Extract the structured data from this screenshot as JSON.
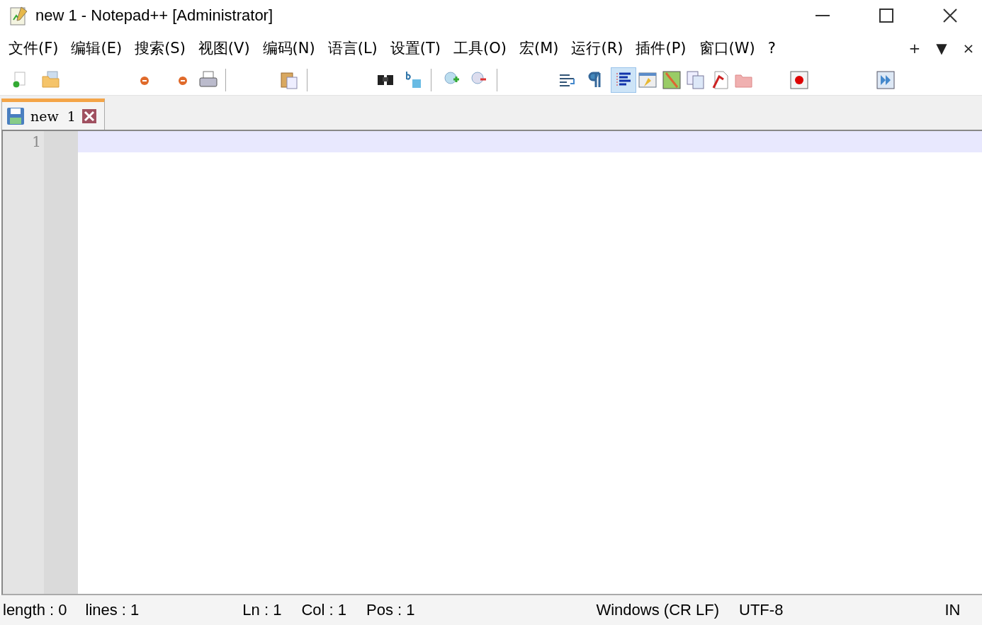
{
  "window": {
    "title": "new 1 - Notepad++ [Administrator]"
  },
  "menu": {
    "items": [
      "文件(F)",
      "编辑(E)",
      "搜索(S)",
      "视图(V)",
      "编码(N)",
      "语言(L)",
      "设置(T)",
      "工具(O)",
      "宏(M)",
      "运行(R)",
      "插件(P)",
      "窗口(W)",
      "?"
    ],
    "right": [
      "+",
      "▼",
      "×"
    ]
  },
  "toolbar": {
    "buttons": [
      {
        "selected": false
      },
      {
        "selected": false
      },
      {
        "selected": false
      },
      {
        "selected": false
      },
      {
        "selected": false
      },
      {
        "selected": false
      },
      {
        "selected": false
      },
      {
        "selected": false
      },
      {
        "selected": false
      },
      {
        "selected": false
      },
      {
        "selected": false
      },
      {
        "selected": false
      },
      {
        "selected": true
      },
      {
        "selected": false
      },
      {
        "selected": false
      },
      {
        "selected": false
      },
      {
        "selected": false
      },
      {
        "selected": false
      },
      {
        "selected": false
      },
      {
        "selected": false
      }
    ]
  },
  "tabs": [
    {
      "label": "new  1",
      "selected": true
    }
  ],
  "editor": {
    "line_numbers": [
      "1"
    ]
  },
  "status_bar": {
    "length": "length : 0",
    "lines": "lines : 1",
    "ln": "Ln : 1",
    "col": "Col : 1",
    "pos": "Pos : 1",
    "eol": "Windows (CR LF)",
    "encoding": "UTF-8",
    "mode": "IN"
  }
}
